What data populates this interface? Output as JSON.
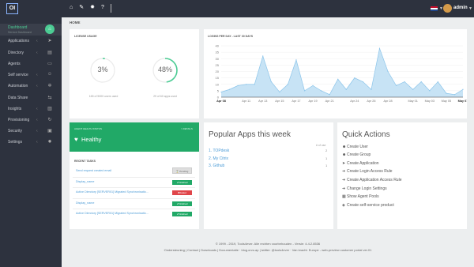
{
  "topbar": {
    "logo": "OI",
    "icons": [
      "home-icon",
      "wrench-icon",
      "gear-icon",
      "help-icon"
    ],
    "user": "admin"
  },
  "sidebar": {
    "items": [
      {
        "label": "Dashboard",
        "sub": "Service Dashboard",
        "icon": "home-icon",
        "active": true
      },
      {
        "label": "Applications",
        "icon": "rocket-icon"
      },
      {
        "label": "Directory",
        "icon": "book-icon"
      },
      {
        "label": "Agents",
        "icon": "monitor-icon"
      },
      {
        "label": "Self service",
        "icon": "user-icon"
      },
      {
        "label": "Automation",
        "icon": "cog-icon"
      },
      {
        "label": "Data Share",
        "icon": "share-icon"
      },
      {
        "label": "Insights",
        "icon": "chart-icon"
      },
      {
        "label": "Provisioning",
        "icon": "refresh-icon"
      },
      {
        "label": "Security",
        "icon": "lock-icon"
      },
      {
        "label": "Settings",
        "icon": "settings-icon"
      }
    ]
  },
  "breadcrumb": "HOME",
  "license": {
    "title": "LICENSE USAGE",
    "users_pct": "3%",
    "users_caption": "165 of 5000 users used",
    "users_fraction": 0.03,
    "apps_pct": "48%",
    "apps_caption": "29 of 60 apps used",
    "apps_fraction": 0.48
  },
  "logins": {
    "title": "LOGINS PER DAY - LAST 30 DAYS"
  },
  "chart_data": {
    "type": "area",
    "title": "LOGINS PER DAY - LAST 30 DAYS",
    "x": [
      "Apr 08",
      "Apr 09",
      "Apr 10",
      "Apr 11",
      "Apr 12",
      "Apr 13",
      "Apr 14",
      "Apr 15",
      "Apr 16",
      "Apr 17",
      "Apr 18",
      "Apr 19",
      "Apr 20",
      "Apr 21",
      "Apr 22",
      "Apr 23",
      "Apr 24",
      "Apr 25",
      "Apr 26",
      "Apr 27",
      "Apr 28",
      "Apr 29",
      "Apr 30",
      "May 01",
      "May 02",
      "May 03",
      "May 04",
      "May 05",
      "May 06",
      "May 07"
    ],
    "xticks": [
      "Apr 08",
      "Apr 11",
      "Apr 13",
      "Apr 15",
      "Apr 17",
      "Apr 19",
      "Apr 21",
      "Apr 24",
      "Apr 26",
      "Apr 28",
      "May 01",
      "May 03",
      "May 05",
      "May 07"
    ],
    "values": [
      4,
      6,
      9,
      10,
      10,
      32,
      12,
      4,
      10,
      29,
      5,
      9,
      5,
      2,
      14,
      6,
      15,
      12,
      6,
      38,
      20,
      9,
      12,
      6,
      12,
      5,
      12,
      3,
      2,
      6
    ],
    "ylim": [
      0,
      40
    ],
    "yticks": [
      0,
      5,
      10,
      15,
      20,
      25,
      30,
      35,
      40
    ],
    "grid": true,
    "color": "#c7e3f5",
    "line_color": "#8cc5ea"
  },
  "health": {
    "header": "AGENT HEALTH STATUS",
    "link": "> DETAILS",
    "status": "Healthy"
  },
  "tasks": {
    "title": "RECENT TASKS",
    "rows": [
      {
        "label": "Send request created email",
        "status": "Pending",
        "kind": "pending"
      },
      {
        "label": "Display_name",
        "status": "Finished",
        "kind": "ok"
      },
      {
        "label": "Active Directory [SERVER01] Migrated Synchronisatio...",
        "status": "Failed",
        "kind": "fail"
      },
      {
        "label": "Display_name",
        "status": "Finished",
        "kind": "ok"
      },
      {
        "label": "Active Directory [SERVER01] Migrated Synchronisatio...",
        "status": "Finished",
        "kind": "ok"
      }
    ]
  },
  "popular": {
    "title": "Popular Apps this week",
    "col": "# of use",
    "rows": [
      {
        "name": "1. TOPdesk",
        "count": "2"
      },
      {
        "name": "2. My Citrix",
        "count": "1"
      },
      {
        "name": "3. Github",
        "count": "1"
      }
    ]
  },
  "quick": {
    "title": "Quick Actions",
    "items": [
      {
        "label": "Create User",
        "icon": "user-icon"
      },
      {
        "label": "Create Group",
        "icon": "group-icon"
      },
      {
        "label": "Create Application",
        "icon": "rocket-icon"
      },
      {
        "label": "Create Login Access Rule",
        "icon": "sign-in-icon"
      },
      {
        "label": "Create Application Access Rule",
        "icon": "sign-in-icon"
      },
      {
        "label": "Change Login Settings",
        "icon": "sign-in-icon"
      },
      {
        "label": "Show Agent Pools",
        "icon": "server-icon"
      },
      {
        "label": "Create self-service product",
        "icon": "product-icon"
      }
    ]
  },
  "footer": {
    "line1": "© 1999 - 2019, Tools4ever. Alle rechten voorbehouden - Versie: 4.4.2.8536",
    "line2": "Ondersteuning | Contact | Downloads | Documentatie · blog.orvo.ap | twitter: @tools4ever · Van kracht: Europe - web-preview customer portal ver.01"
  },
  "colors": {
    "accent": "#4ccc94",
    "health": "#21a967",
    "sidebar": "#2d323e",
    "finished": "#21a967",
    "failed": "#e0454a"
  }
}
